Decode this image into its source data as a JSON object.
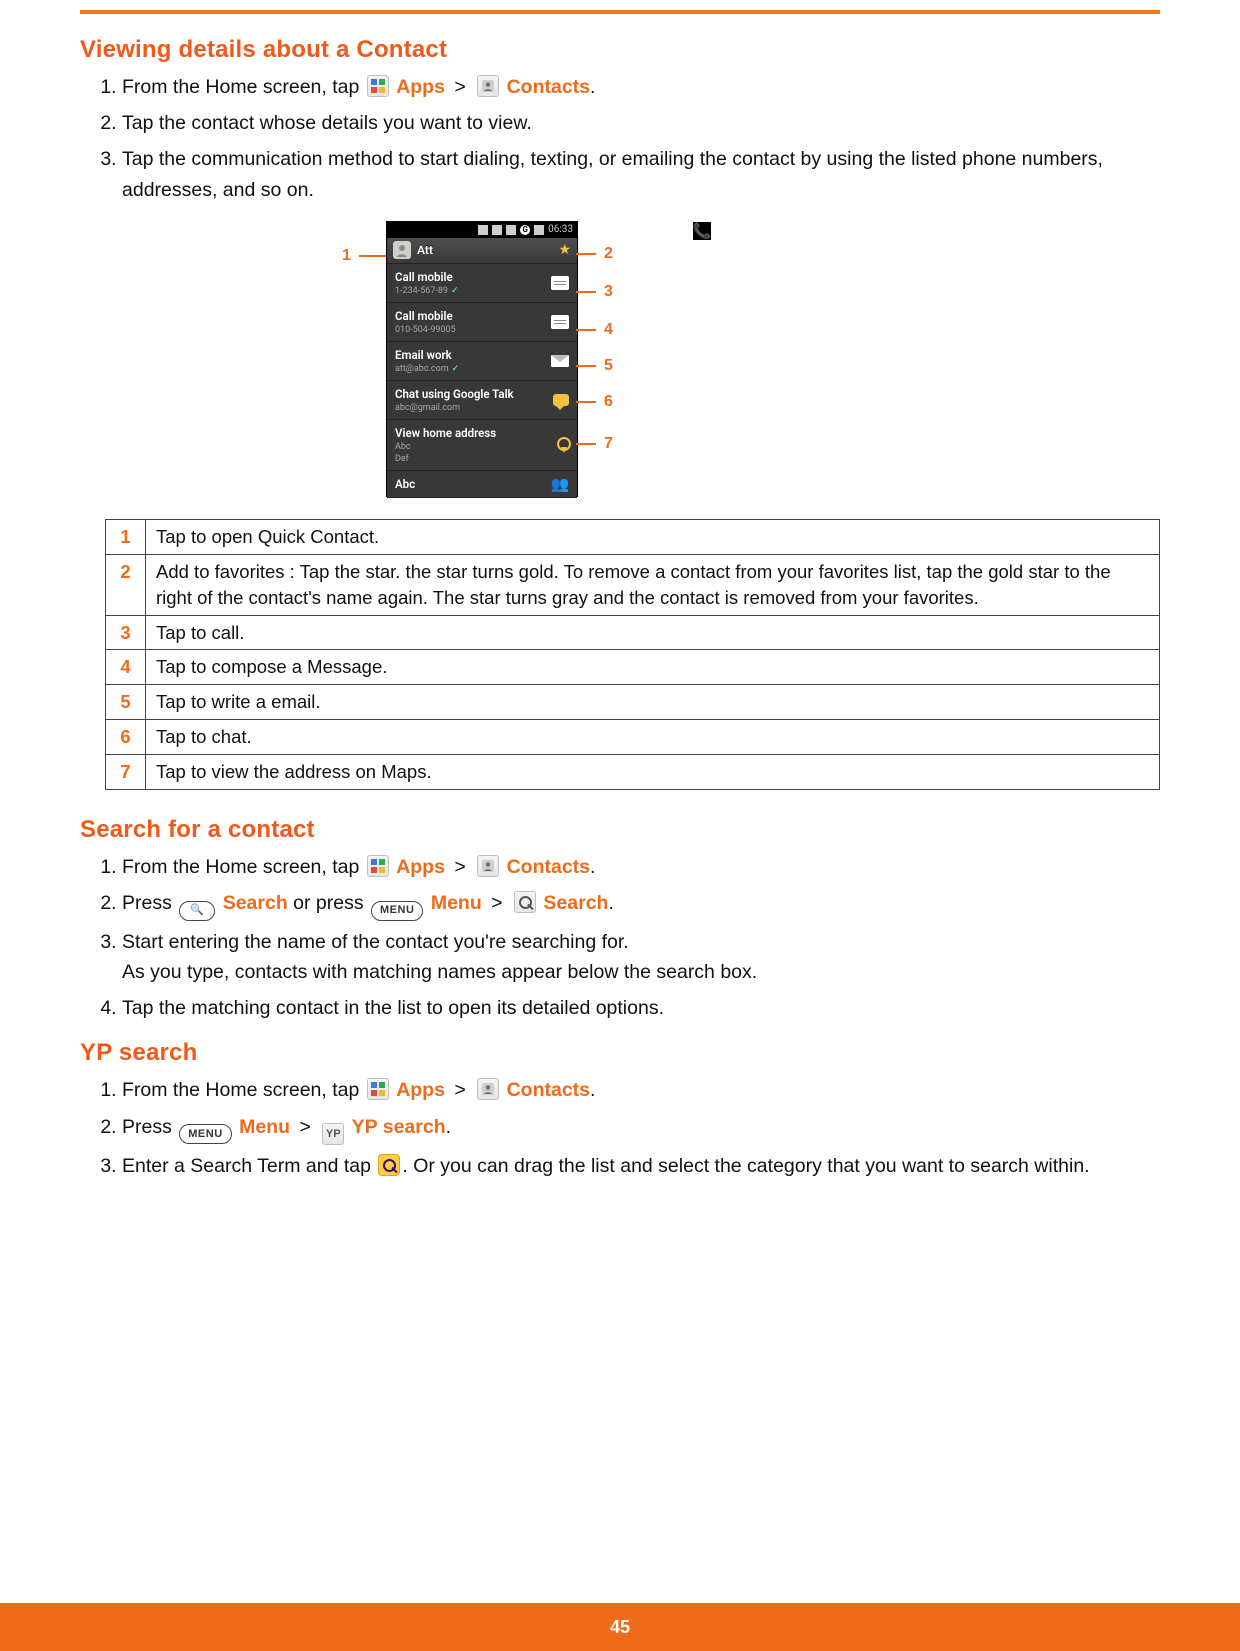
{
  "page_number": "45",
  "sections": {
    "s1": {
      "title": "Viewing details about a Contact",
      "steps": {
        "1a": "From the Home screen, tap ",
        "1_apps": "Apps",
        "1_gt": " > ",
        "1_contacts": "Contacts",
        "1b": ".",
        "2": "Tap the contact whose details you want to view.",
        "3": "Tap the communication method to start dialing, texting, or emailing the contact by using the listed phone numbers, addresses, and so on."
      }
    },
    "s2": {
      "title": "Search for a contact",
      "steps": {
        "1a": "From the Home screen, tap ",
        "1_apps": "Apps",
        "1_gt": " > ",
        "1_contacts": "Contacts",
        "1b": ".",
        "2a": "Press ",
        "2_search": "Search",
        "2_or": " or press ",
        "2_menu_label": "Menu",
        "2_gt": " > ",
        "2_search2": "Search",
        "2b": ".",
        "3a": "Start entering the name of the contact you're searching for.",
        "3b": "As you type, contacts with matching names appear below the search box.",
        "4": "Tap the matching contact in the list to open its detailed options."
      }
    },
    "s3": {
      "title": "YP search",
      "steps": {
        "1a": "From the Home screen, tap ",
        "1_apps": "Apps",
        "1_gt": " > ",
        "1_contacts": "Contacts",
        "1b": ".",
        "2a": "Press ",
        "2_menu_label": "Menu",
        "2_gt": " > ",
        "2_yp": "YP search",
        "2b": ".",
        "3a": "Enter a Search Term and tap ",
        "3b": ". Or you can drag the list and select the category that you want to search within."
      }
    }
  },
  "pill": {
    "search_glyph": "🔍",
    "menu_label": "MENU"
  },
  "phone": {
    "time": "06:33",
    "status_icon_g": "G",
    "name": "Att",
    "rows": {
      "r1": {
        "main": "Call mobile",
        "sub": "1-234-567-89"
      },
      "r2": {
        "main": "Call mobile",
        "sub": "010-504-99005"
      },
      "r3": {
        "main": "Email work",
        "sub": "att@abc.com"
      },
      "r4": {
        "main": "Chat using Google Talk",
        "sub": "abc@gmail.com"
      },
      "r5": {
        "main": "View home address",
        "sub1": "Abc",
        "sub2": "Def"
      },
      "r6": {
        "main": "Abc"
      }
    }
  },
  "callouts": {
    "c1": "1",
    "c2": "2",
    "c3": "3",
    "c4": "4",
    "c5": "5",
    "c6": "6",
    "c7": "7"
  },
  "legend": {
    "r1": "Tap to open Quick Contact.",
    "r2": "Add to favorites : Tap the star. the star turns gold. To remove a contact from your favorites list, tap the gold star to the right of the contact's name again. The star turns gray and the contact is removed from your favorites.",
    "r3": "Tap to call.",
    "r4": "Tap to compose a Message.",
    "r5": "Tap to write a email.",
    "r6": "Tap to chat.",
    "r7": "Tap to view the address on Maps."
  }
}
